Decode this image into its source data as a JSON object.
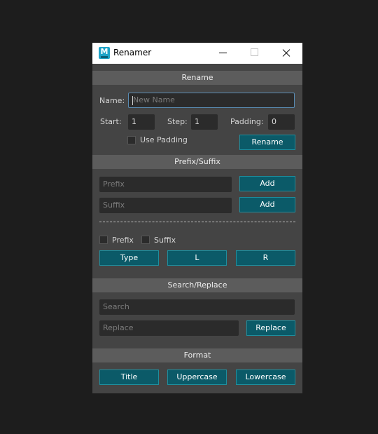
{
  "window": {
    "title": "Renamer",
    "icon_letter": "M"
  },
  "rename": {
    "header": "Rename",
    "name_label": "Name:",
    "name_placeholder": "New Name",
    "start_label": "Start:",
    "start_value": "1",
    "step_label": "Step:",
    "step_value": "1",
    "padding_label": "Padding:",
    "padding_value": "0",
    "use_padding_label": "Use Padding",
    "rename_button": "Rename"
  },
  "prefix_suffix": {
    "header": "Prefix/Suffix",
    "prefix_placeholder": "Prefix",
    "suffix_placeholder": "Suffix",
    "add_prefix_button": "Add",
    "add_suffix_button": "Add",
    "prefix_check_label": "Prefix",
    "suffix_check_label": "Suffix",
    "type_button": "Type",
    "l_button": "L",
    "r_button": "R"
  },
  "search_replace": {
    "header": "Search/Replace",
    "search_placeholder": "Search",
    "replace_placeholder": "Replace",
    "replace_button": "Replace"
  },
  "format": {
    "header": "Format",
    "title_button": "Title",
    "uppercase_button": "Uppercase",
    "lowercase_button": "Lowercase"
  },
  "colors": {
    "button_fill": "#0b5a68",
    "panel_bg": "#444444",
    "header_bg": "#5c5c5c",
    "field_bg": "#2b2b2b"
  }
}
